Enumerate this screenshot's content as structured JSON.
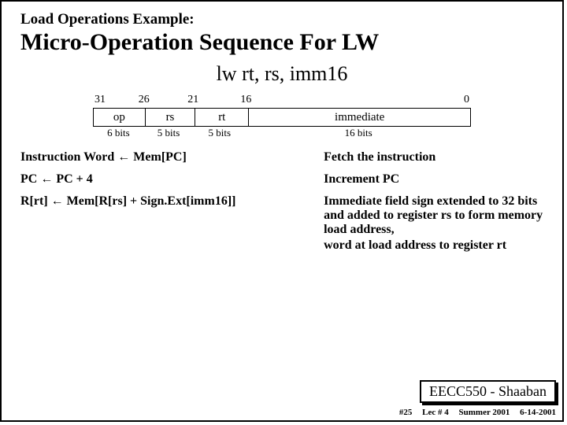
{
  "pretitle": "Load Operations Example:",
  "title": "Micro-Operation Sequence For  LW",
  "syntax": "lw rt, rs, imm16",
  "bits": {
    "b31": "31",
    "b26": "26",
    "b21": "21",
    "b16": "16",
    "b0": "0"
  },
  "fields": {
    "op": "op",
    "rs": "rs",
    "rt": "rt",
    "imm": "immediate"
  },
  "widths": {
    "op": "6 bits",
    "rs": "5 bits",
    "rt": "5 bits",
    "imm": "16 bits"
  },
  "steps": {
    "s1": {
      "lhs": "Instruction Word  ←     Mem[PC]",
      "rhs": "Fetch the instruction"
    },
    "s2": {
      "lhs": "PC  ←  PC + 4",
      "rhs": "Increment PC"
    },
    "s3": {
      "lhs": "R[rt]  ←  Mem[R[rs] + Sign.Ext[imm16]]",
      "rhs1": "Immediate field sign extended to 32 bits and added to register rs to form memory load address,",
      "rhs2": "word at load address to register rt"
    }
  },
  "footer": {
    "course": "EECC550 - Shaaban",
    "slide": "#25",
    "lec": "Lec # 4",
    "term": "Summer 2001",
    "date": "6-14-2001"
  }
}
